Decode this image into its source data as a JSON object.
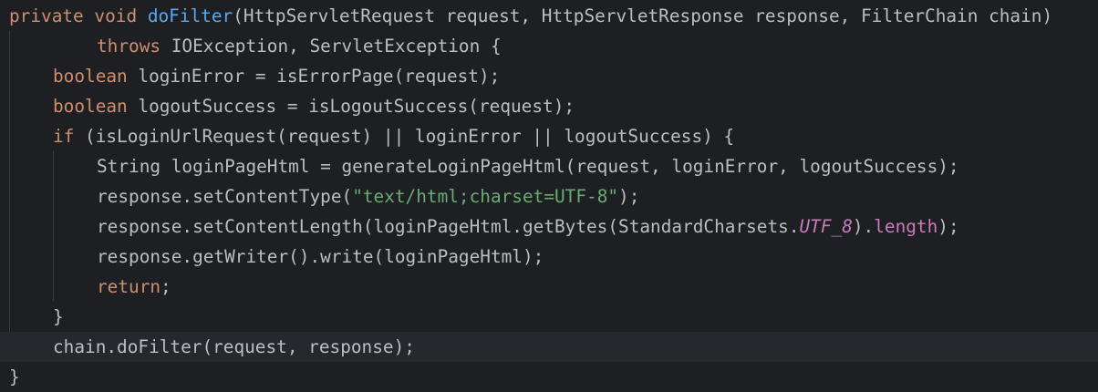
{
  "editor": {
    "colors": {
      "background": "#1e1f22",
      "current_line": "#26282e",
      "keyword": "#cf8e6d",
      "method_declaration": "#56a8f5",
      "string": "#6aab73",
      "field": "#c77dbb",
      "text": "#bcbec4",
      "indent_guide": "#393b40"
    },
    "lines": [
      {
        "indent": 0,
        "tokens": [
          {
            "t": "private",
            "k": "kw"
          },
          {
            "t": " "
          },
          {
            "t": "void",
            "k": "kw"
          },
          {
            "t": " "
          },
          {
            "t": "doFilter",
            "k": "fn"
          },
          {
            "t": "(HttpServletRequest request, HttpServletResponse response, FilterChain chain)"
          }
        ]
      },
      {
        "indent": 8,
        "tokens": [
          {
            "t": "throws",
            "k": "kw"
          },
          {
            "t": " IOException, ServletException {"
          }
        ]
      },
      {
        "indent": 4,
        "tokens": [
          {
            "t": "boolean",
            "k": "kw"
          },
          {
            "t": " loginError = isErrorPage(request);"
          }
        ]
      },
      {
        "indent": 4,
        "tokens": [
          {
            "t": "boolean",
            "k": "kw"
          },
          {
            "t": " logoutSuccess = isLogoutSuccess(request);"
          }
        ]
      },
      {
        "indent": 4,
        "tokens": [
          {
            "t": "if",
            "k": "kw"
          },
          {
            "t": " (isLoginUrlRequest(request) || loginError || logoutSuccess) {"
          }
        ]
      },
      {
        "indent": 8,
        "tokens": [
          {
            "t": "String loginPageHtml = generateLoginPageHtml(request, loginError, logoutSuccess);"
          }
        ]
      },
      {
        "indent": 8,
        "tokens": [
          {
            "t": "response.setContentType("
          },
          {
            "t": "\"text/html;charset=UTF-8\"",
            "k": "str"
          },
          {
            "t": ");"
          }
        ]
      },
      {
        "indent": 8,
        "tokens": [
          {
            "t": "response.setContentLength(loginPageHtml.getBytes(StandardCharsets."
          },
          {
            "t": "UTF_8",
            "k": "cst"
          },
          {
            "t": ")."
          },
          {
            "t": "length",
            "k": "fld"
          },
          {
            "t": ");"
          }
        ]
      },
      {
        "indent": 8,
        "tokens": [
          {
            "t": "response.getWriter().write(loginPageHtml);"
          }
        ]
      },
      {
        "indent": 8,
        "tokens": [
          {
            "t": "return",
            "k": "kw"
          },
          {
            "t": ";"
          }
        ]
      },
      {
        "indent": 4,
        "tokens": [
          {
            "t": "}"
          }
        ]
      },
      {
        "indent": 4,
        "current": true,
        "tokens": [
          {
            "t": "chain.doFilter(request, response);"
          }
        ]
      },
      {
        "indent": 0,
        "tokens": [
          {
            "t": "}"
          }
        ]
      }
    ]
  }
}
